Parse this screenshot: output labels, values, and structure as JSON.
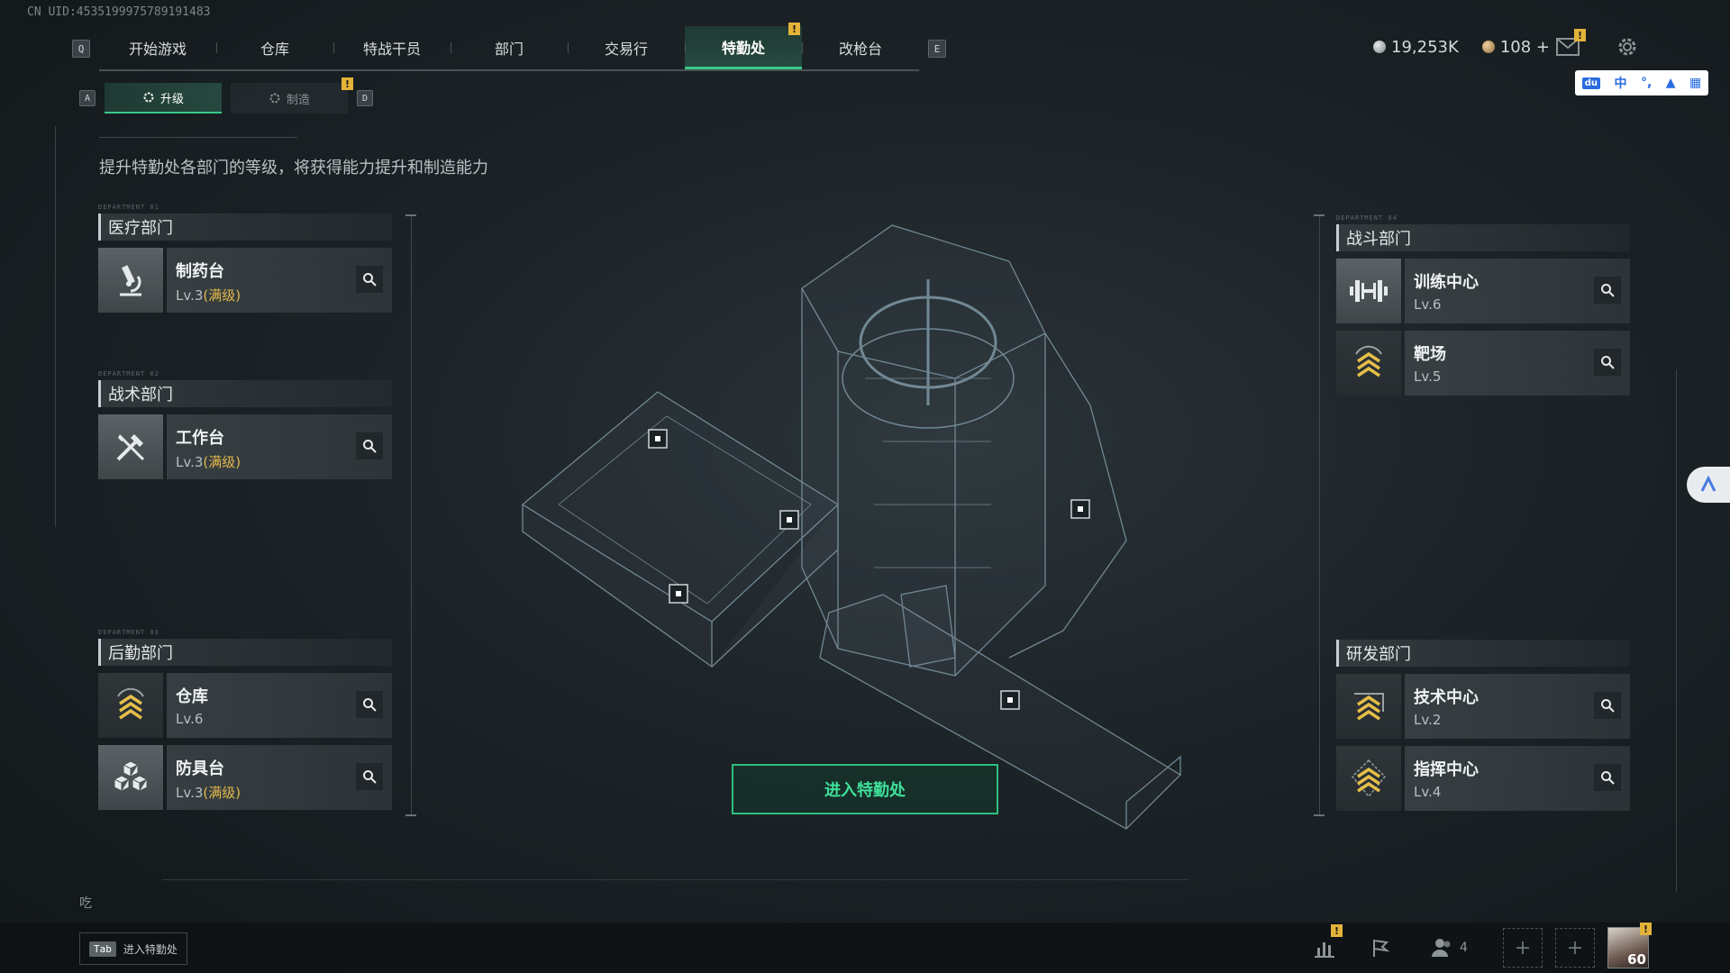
{
  "uid": "CN UID:4535199975789191483",
  "nav": {
    "left_key": "Q",
    "right_key": "E",
    "tabs": [
      "开始游戏",
      "仓库",
      "特战干员",
      "部门",
      "交易行",
      "特勤处",
      "改枪台"
    ],
    "active_tab": "特勤处"
  },
  "currency": {
    "silver": "19,253K",
    "gold": "108 +"
  },
  "ime": {
    "lang": "中"
  },
  "subnav": {
    "left_key": "A",
    "right_key": "D",
    "tabs": [
      {
        "label": "升级"
      },
      {
        "label": "制造"
      }
    ]
  },
  "description": "提升特勤处各部门的等级，将获得能力提升和制造能力",
  "departments": {
    "medical": {
      "tag": "DEPARTMENT 01",
      "title": "医疗部门",
      "items": [
        {
          "name": "制药台",
          "level": "Lv.3",
          "max": "(满级)",
          "icon": "microscope-icon"
        }
      ]
    },
    "tactical": {
      "tag": "DEPARTMENT 02",
      "title": "战术部门",
      "items": [
        {
          "name": "工作台",
          "level": "Lv.3",
          "max": "(满级)",
          "icon": "tools-icon"
        }
      ]
    },
    "logistics": {
      "tag": "DEPARTMENT 03",
      "title": "后勤部门",
      "items": [
        {
          "name": "仓库",
          "level": "Lv.6",
          "max": "",
          "icon": "rank-chevron-icon"
        },
        {
          "name": "防具台",
          "level": "Lv.3",
          "max": "(满级)",
          "icon": "cubes-icon"
        }
      ]
    },
    "combat": {
      "tag": "DEPARTMENT 04",
      "title": "战斗部门",
      "items": [
        {
          "name": "训练中心",
          "level": "Lv.6",
          "icon": "dumbbell-icon"
        },
        {
          "name": "靶场",
          "level": "Lv.5",
          "icon": "rank-chevron-icon"
        }
      ]
    },
    "research": {
      "title": "研发部门",
      "items": [
        {
          "name": "技术中心",
          "level": "Lv.2",
          "icon": "rank-chevron-icon"
        },
        {
          "name": "指挥中心",
          "level": "Lv.4",
          "icon": "rank-chevron-icon"
        }
      ]
    }
  },
  "enter_button": "进入特勤处",
  "bottom": {
    "tab_key": "Tab",
    "tab_label": "进入特勤处",
    "team_count": "4",
    "avatar_level": "60",
    "chat_glyph": "吃"
  },
  "colors": {
    "accent_green": "#38c98a",
    "alert_yellow": "#e3b339",
    "max_gold": "#e2b94a"
  }
}
